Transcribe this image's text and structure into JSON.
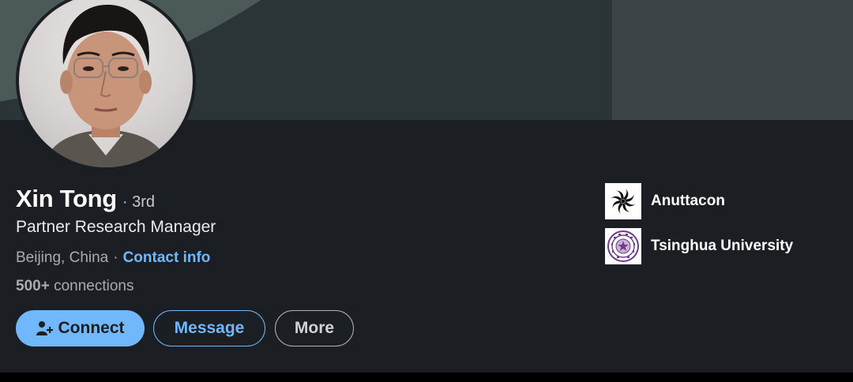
{
  "profile": {
    "name": "Xin Tong",
    "degree": "· 3rd",
    "headline": "Partner Research Manager",
    "location": "Beijing, China",
    "separator": "·",
    "contact_label": "Contact info",
    "connections_count": "500+",
    "connections_label": "connections"
  },
  "actions": {
    "connect": "Connect",
    "message": "Message",
    "more": "More"
  },
  "organizations": [
    {
      "name": "Anuttacon",
      "logo": "anuttacon-logo"
    },
    {
      "name": "Tsinghua University",
      "logo": "tsinghua-seal-logo"
    }
  ],
  "colors": {
    "accent": "#71b7fb",
    "card_bg": "#1b1f23",
    "banner": "#4b5958"
  }
}
